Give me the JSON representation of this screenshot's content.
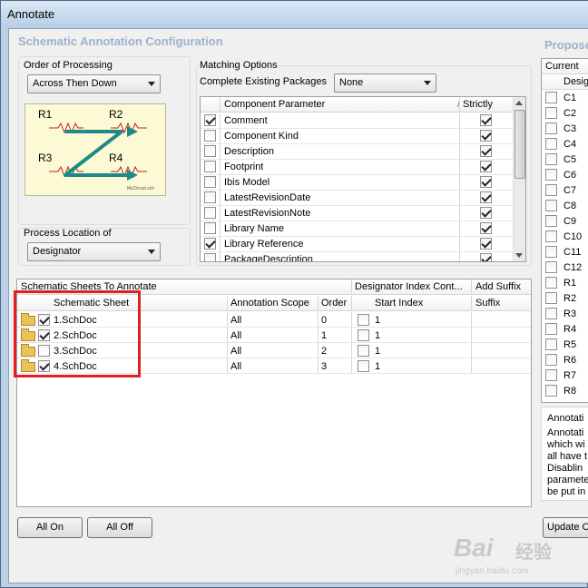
{
  "window": {
    "title": "Annotate"
  },
  "config": {
    "header": "Schematic Annotation Configuration",
    "order_of_processing": {
      "label": "Order of Processing",
      "selected": "Across Then Down",
      "diagram": {
        "labels": [
          "R1",
          "R2",
          "R3",
          "R4"
        ],
        "footer": "MyCircuit.sch"
      }
    },
    "matching": {
      "label": "Matching Options",
      "complete_label": "Complete Existing Packages",
      "complete_value": "None",
      "columns": [
        "Component Parameter",
        "/",
        "Strictly"
      ],
      "rows": [
        {
          "name": "Comment",
          "checked": true,
          "strict": true
        },
        {
          "name": "Component Kind",
          "checked": false,
          "strict": true
        },
        {
          "name": "Description",
          "checked": false,
          "strict": true
        },
        {
          "name": "Footprint",
          "checked": false,
          "strict": true
        },
        {
          "name": "Ibis Model",
          "checked": false,
          "strict": true
        },
        {
          "name": "LatestRevisionDate",
          "checked": false,
          "strict": true
        },
        {
          "name": "LatestRevisionNote",
          "checked": false,
          "strict": true
        },
        {
          "name": "Library Name",
          "checked": false,
          "strict": true
        },
        {
          "name": "Library Reference",
          "checked": true,
          "strict": true
        },
        {
          "name": "PackageDescription",
          "checked": false,
          "strict": true
        }
      ]
    },
    "process_location": {
      "label": "Process Location of",
      "selected": "Designator"
    }
  },
  "sheets": {
    "group_headers": [
      "Schematic Sheets To Annotate",
      "Designator Index Cont...",
      "Add Suffix"
    ],
    "columns": [
      "Schematic Sheet",
      "Annotation Scope",
      "Order",
      "Start Index",
      "Suffix"
    ],
    "rows": [
      {
        "name": "1.SchDoc",
        "checked": true,
        "scope": "All",
        "order": "0",
        "start_checked": false,
        "start": "1"
      },
      {
        "name": "2.SchDoc",
        "checked": true,
        "scope": "All",
        "order": "1",
        "start_checked": false,
        "start": "1"
      },
      {
        "name": "3.SchDoc",
        "checked": false,
        "scope": "All",
        "order": "2",
        "start_checked": false,
        "start": "1"
      },
      {
        "name": "4.SchDoc",
        "checked": true,
        "scope": "All",
        "order": "3",
        "start_checked": false,
        "start": "1"
      }
    ],
    "highlight_color": "#e02020"
  },
  "buttons": {
    "all_on": "All On",
    "all_off": "All Off",
    "update": "Update C"
  },
  "proposed": {
    "header": "Propose",
    "current_label": "Current",
    "designator_col": "Desig",
    "items": [
      "C1",
      "C2",
      "C3",
      "C4",
      "C5",
      "C6",
      "C7",
      "C8",
      "C9",
      "C10",
      "C11",
      "C12",
      "R1",
      "R2",
      "R3",
      "R4",
      "R5",
      "R6",
      "R7",
      "R8"
    ]
  },
  "annotation_note": {
    "lines": [
      "Annotati",
      "Annotati",
      "which wi",
      "all have t",
      "Disablin",
      "paramete",
      "be put in"
    ]
  },
  "watermark": {
    "brand": "Bai",
    "sub": "经验",
    "url": "jingyan.baidu.com"
  }
}
